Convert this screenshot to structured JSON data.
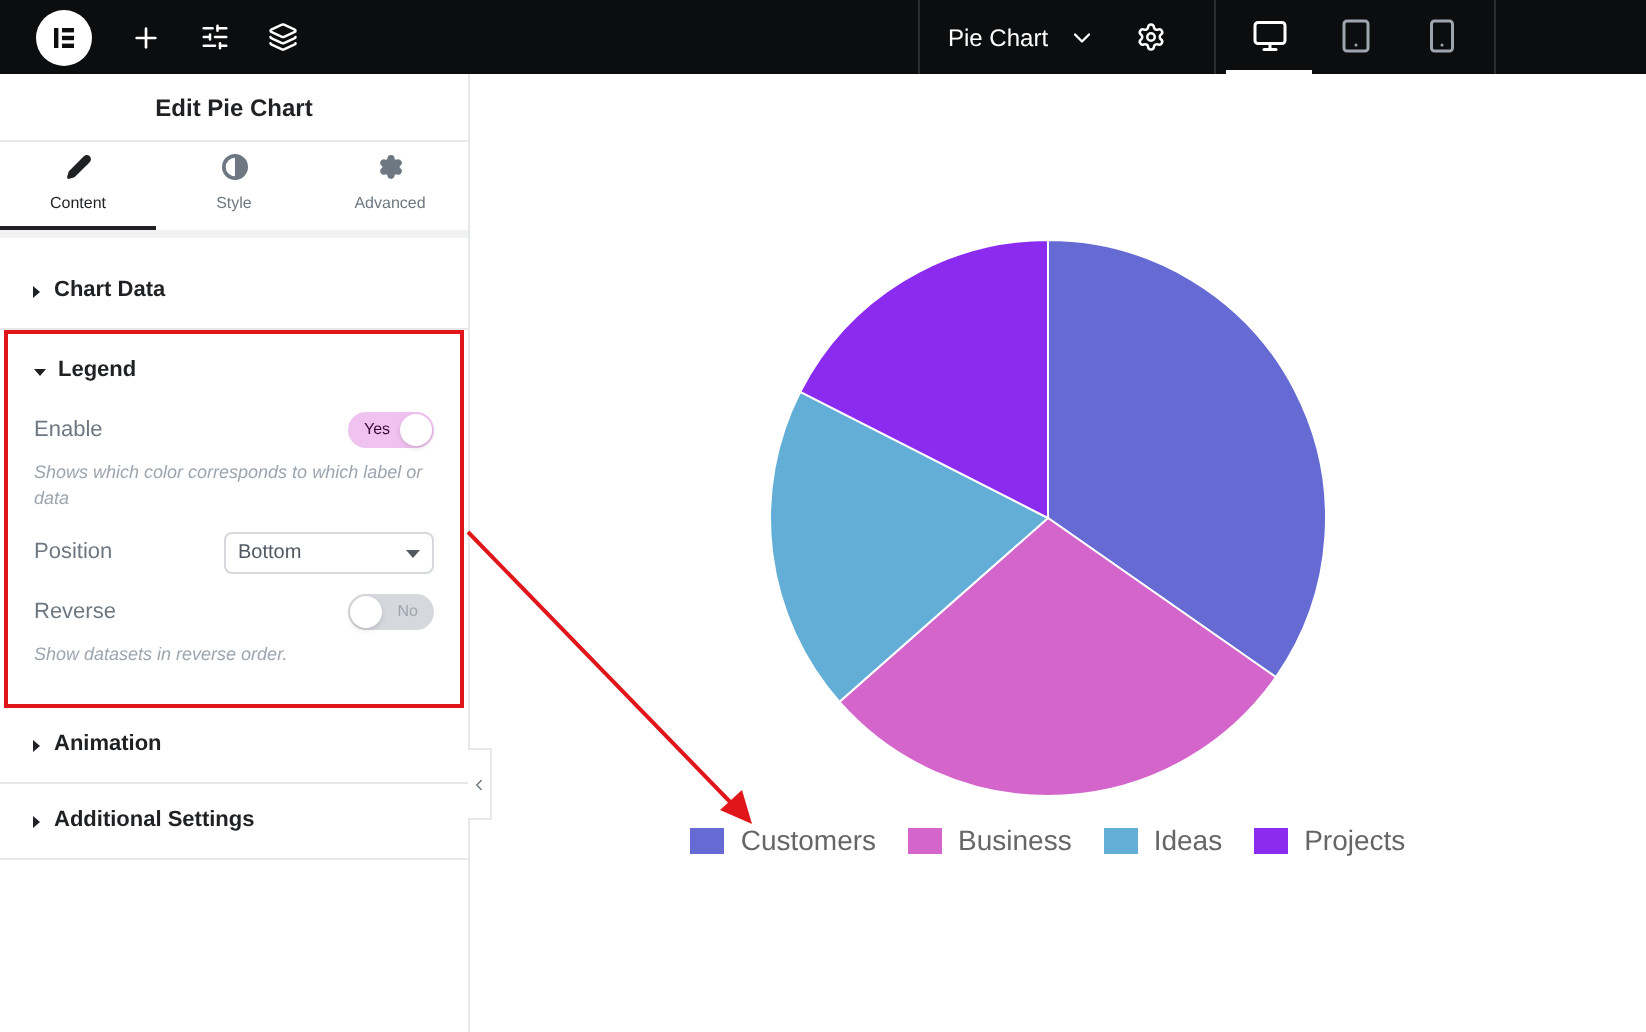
{
  "top_bar": {
    "page_title": "Pie Chart"
  },
  "devices": [
    {
      "kind": "desktop",
      "selected": true
    },
    {
      "kind": "tablet",
      "selected": false
    },
    {
      "kind": "mobile",
      "selected": false
    }
  ],
  "panel": {
    "title": "Edit Pie Chart",
    "tabs": [
      {
        "kind": "content",
        "label": "Content",
        "selected": true
      },
      {
        "kind": "style",
        "label": "Style",
        "selected": false
      },
      {
        "kind": "advanced",
        "label": "Advanced",
        "selected": false
      }
    ],
    "sections": [
      {
        "title": "Chart Data",
        "expanded": false,
        "highlighted": false
      },
      {
        "title": "Legend",
        "expanded": true,
        "highlighted": true,
        "controls": [
          {
            "kind": "switch",
            "label": "Enable",
            "on": true,
            "state_text": "Yes",
            "hint": "Shows which color corresponds to which label or data"
          },
          {
            "kind": "select",
            "label": "Position",
            "value": "Bottom"
          },
          {
            "kind": "switch",
            "label": "Reverse",
            "on": false,
            "state_text": "No",
            "hint": "Show datasets in reverse order."
          }
        ]
      },
      {
        "title": "Animation",
        "expanded": false,
        "highlighted": false
      },
      {
        "title": "Additional Settings",
        "expanded": false,
        "highlighted": false
      }
    ]
  },
  "chart": {
    "legend": [
      {
        "label": "Customers",
        "color": "#666bd4"
      },
      {
        "label": "Business",
        "color": "#d466cb"
      },
      {
        "label": "Ideas",
        "color": "#62aed6"
      },
      {
        "label": "Projects",
        "color": "#8c2bf0"
      }
    ]
  }
}
